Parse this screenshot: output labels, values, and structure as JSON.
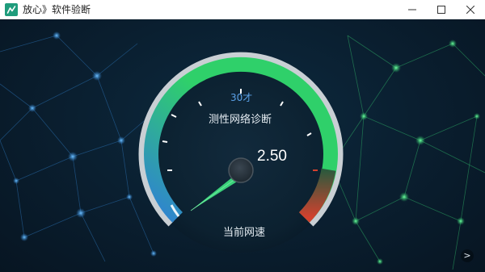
{
  "window": {
    "title": "放心》软件验断",
    "controls": [
      "minimize",
      "maximize",
      "close"
    ]
  },
  "gauge": {
    "max_label": "30才",
    "title": "测性网络诊断",
    "value_text": "2.50",
    "value": 2.5,
    "caption": "当前网速",
    "colors": {
      "blue": "#2f7fd6",
      "green": "#2fd06a",
      "red": "#d2412e",
      "needle": "#3ad07a"
    }
  },
  "footer": {
    "next_symbol": ">"
  }
}
